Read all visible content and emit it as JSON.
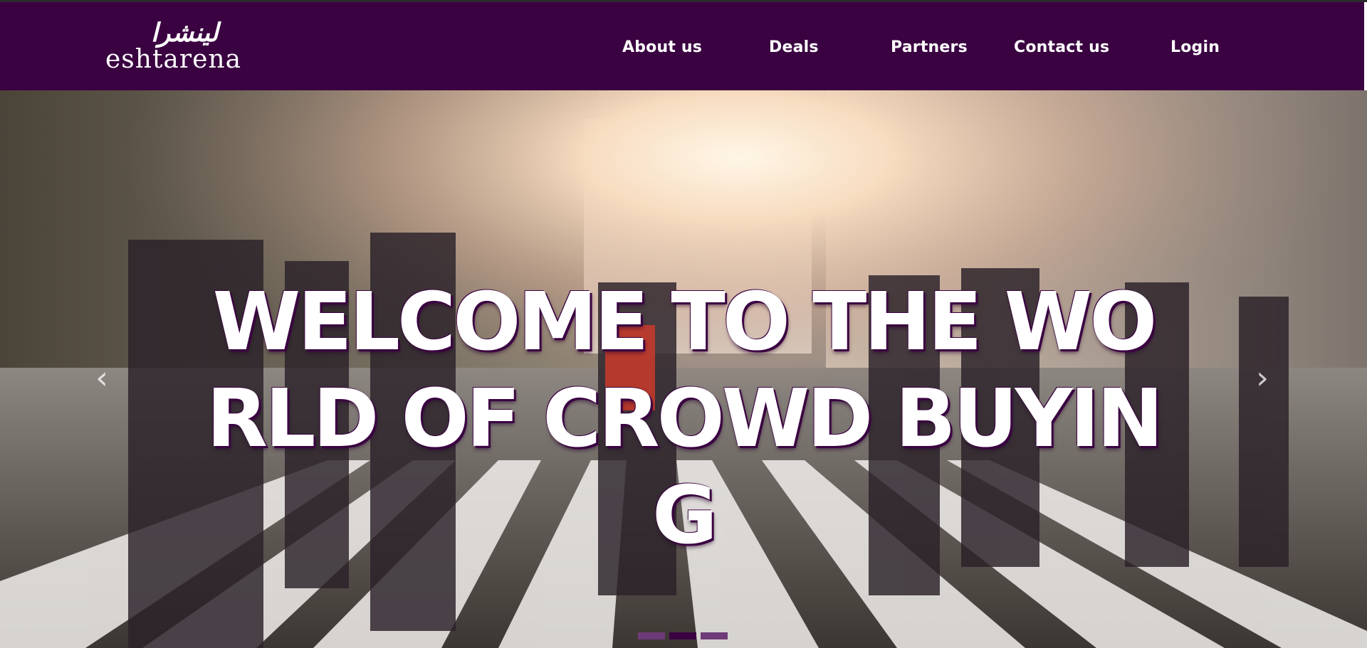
{
  "brand": {
    "arabic_text": "لينشرا",
    "latin_text": "eshtarena"
  },
  "nav": {
    "items": [
      {
        "label": "About us"
      },
      {
        "label": "Deals"
      },
      {
        "label": "Partners"
      },
      {
        "label": "Contact us"
      },
      {
        "label": "Login"
      }
    ]
  },
  "hero": {
    "headline": "WELCOME TO THE WORLD OF CROWD BUYING",
    "prev_arrow": "‹",
    "next_arrow": "›",
    "slides_total": 3,
    "active_slide": 2
  },
  "colors": {
    "brand_purple": "#3a0241",
    "indicator_inactive": "#6e3a78",
    "indicator_active": "#3a0241"
  }
}
